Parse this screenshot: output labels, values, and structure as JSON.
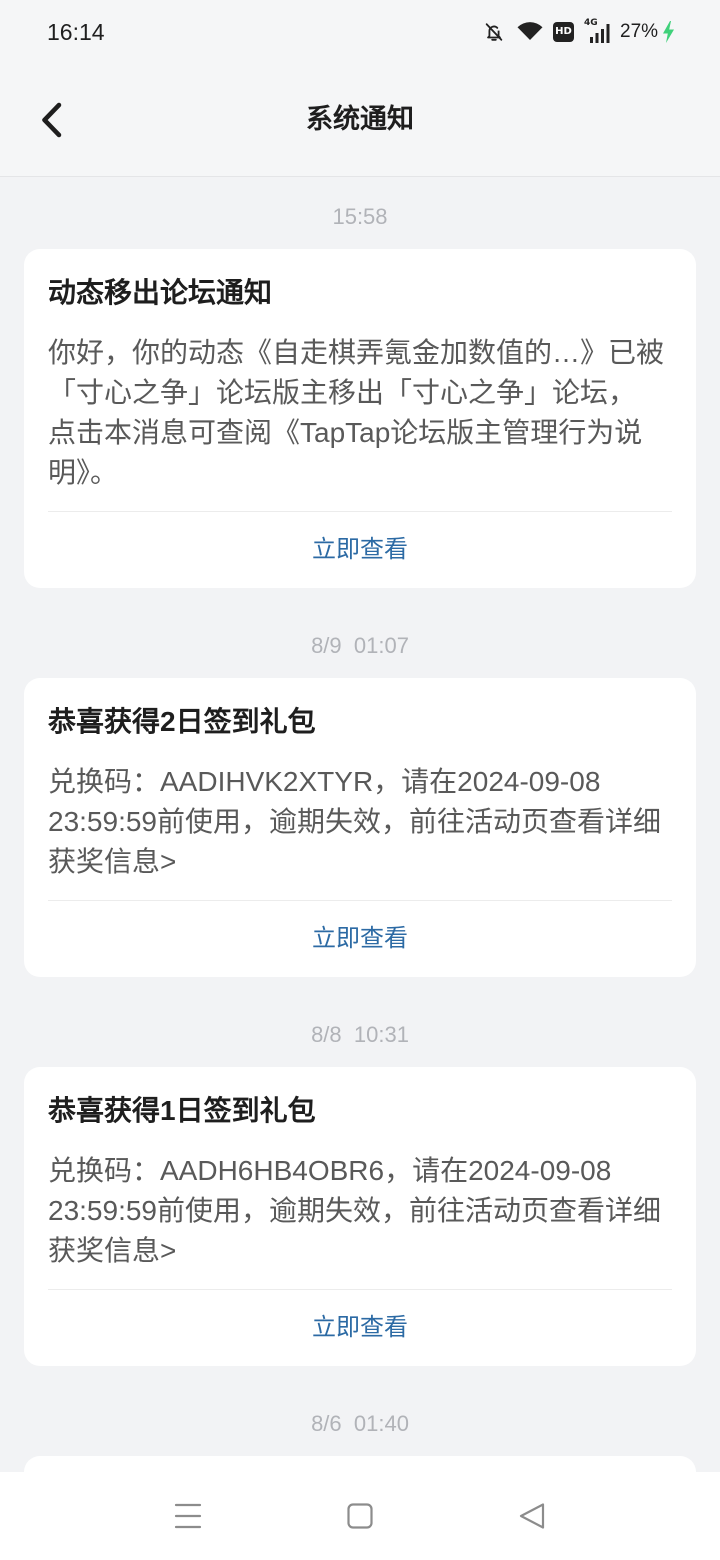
{
  "status_bar": {
    "time": "16:14",
    "hd_label": "HD",
    "network": "4G",
    "battery": "27%",
    "icons": [
      "bell-off-icon",
      "wifi-icon",
      "signal-icon",
      "charging-bolt-icon"
    ]
  },
  "header": {
    "title": "系统通知",
    "back_icon": "chevron-left-icon"
  },
  "notifications": [
    {
      "time": "15:58",
      "title": "动态移出论坛通知",
      "body_lines": [
        "你好，你的动态《自走棋弄氪金加数值的…》已被",
        "「寸心之争」论坛版主移出「寸心之争」论坛，",
        "点击本消息可查阅《TapTap论坛版主管理行为说",
        "明》。"
      ],
      "action": "立即查看"
    },
    {
      "time": "8/9  01:07",
      "title": "恭喜获得2日签到礼包",
      "body_lines": [
        "兑换码：AADIHVK2XTYR，请在2024-09-08",
        "23:59:59前使用，逾期失效，前往活动页查看详细",
        "获奖信息>"
      ],
      "action": "立即查看"
    },
    {
      "time": "8/8  10:31",
      "title": "恭喜获得1日签到礼包",
      "body_lines": [
        "兑换码：AADH6HB4OBR6，请在2024-09-08",
        "23:59:59前使用，逾期失效，前往活动页查看详细",
        "获奖信息>"
      ],
      "action": "立即查看"
    },
    {
      "time": "8/6  01:40"
    }
  ],
  "nav_bar": {
    "icons": [
      "menu-icon",
      "home-icon",
      "back-triangle-icon"
    ]
  },
  "colors": {
    "page_background": "#f2f3f5",
    "card_background": "#ffffff",
    "action_link": "#2c6aa4",
    "timestamp_text": "#b1b3b8",
    "charging": "#3fd17a"
  }
}
